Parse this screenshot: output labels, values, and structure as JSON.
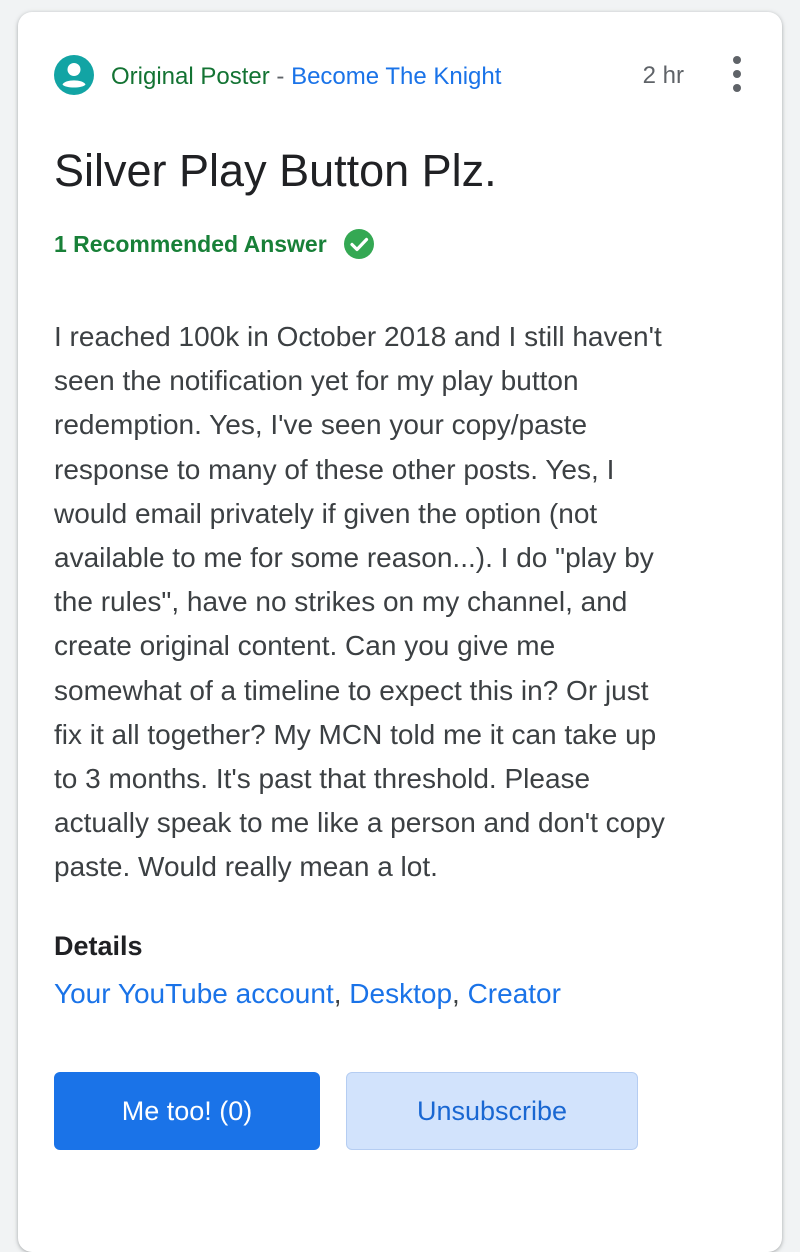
{
  "post": {
    "role": "Original Poster",
    "separator": " - ",
    "author": "Become The Knight",
    "time": "2 hr",
    "title": "Silver Play Button Plz.",
    "recommended_label": "1 Recommended Answer",
    "body_lines": [
      "I reached 100k in October 2018 and I still haven't",
      "seen the notification yet for my play button",
      "redemption. Yes, I've seen your copy/paste",
      "response to many of these other posts. Yes, I",
      "would email privately if given the option (not",
      "available to me for some reason...). I do \"play by",
      "the rules\", have no strikes on my channel, and",
      "create original content. Can you give me",
      "somewhat of a timeline to expect this in? Or just",
      "fix it all together? My MCN told me it can take up",
      "to 3 months. It's past that threshold. Please",
      "actually speak to me like a person and don't copy",
      "paste. Would really mean a lot."
    ]
  },
  "details": {
    "title": "Details",
    "tags": [
      "Your YouTube account",
      "Desktop",
      "Creator"
    ],
    "separator": ", "
  },
  "actions": {
    "me_too_label": "Me too! (0)",
    "unsubscribe_label": "Unsubscribe"
  },
  "icons": {
    "avatar": "account-circle-icon",
    "check": "check-circle-icon",
    "more": "more-vert-icon"
  },
  "colors": {
    "avatar_teal": "#12a4a4",
    "role_green": "#137333",
    "link_blue": "#1a73e8",
    "check_green": "#34a853",
    "primary_button": "#1a73e8",
    "secondary_button": "#d2e3fc"
  }
}
